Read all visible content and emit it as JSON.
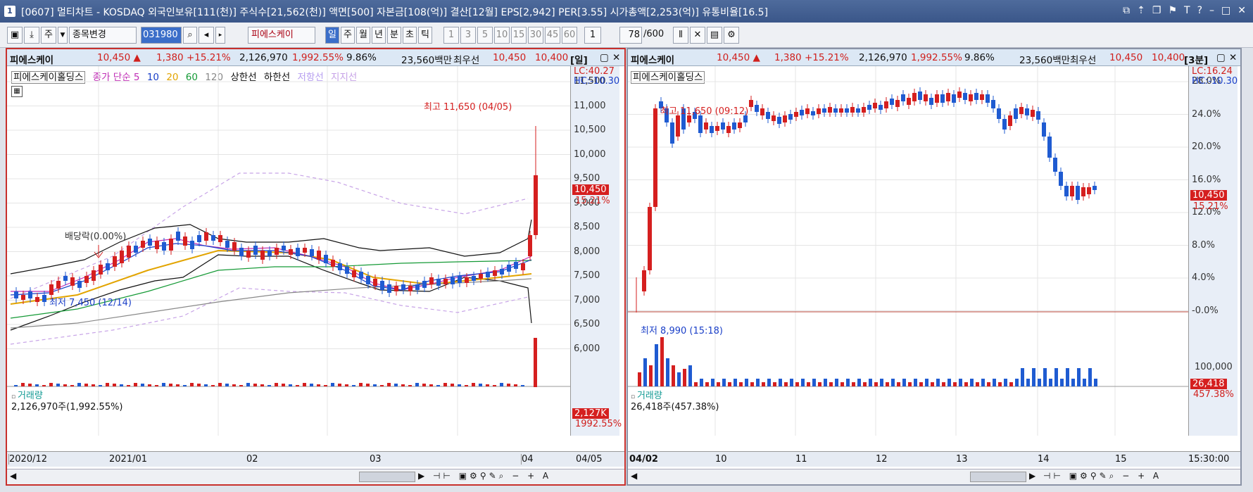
{
  "window": {
    "num": "1",
    "title": "[0607] 멀티차트 - KOSDAQ 외국인보유[111(천)] 주식수[21,562(천)] 액면[500] 자본금[108(억)] 결산[12월] EPS[2,942] PER[3.55] 시가총액[2,253(억)] 유통비율[16.5]"
  },
  "toolbar": {
    "period_type": "주",
    "mode": "종목변경",
    "code": "031980",
    "stock": "피에스케이",
    "periods": [
      "일",
      "주",
      "월",
      "년",
      "분",
      "초",
      "틱"
    ],
    "nums": [
      "1",
      "3",
      "5",
      "10",
      "15",
      "30",
      "45",
      "60"
    ],
    "count": "1",
    "ratio": "78",
    "total": "/600"
  },
  "left": {
    "header": {
      "name": "피에스케이",
      "price": "10,450 ▲",
      "change": "1,380 +15.21%",
      "volume": "2,126,970",
      "vol_pct": "1,992.55%",
      "turnover": "9.86%",
      "amount": "23,560백만",
      "bid_label": "최우선",
      "ask": "10,450",
      "bid": "10,400",
      "period": "[일]"
    },
    "legend": {
      "name": "피에스케이홀딩스",
      "close": "종가 단순 5",
      "ma10": "10",
      "ma20": "20",
      "ma60": "60",
      "ma120": "120",
      "upper": "상한선",
      "lower": "하한선",
      "resist": "저항선",
      "support": "지지선"
    },
    "lc": "LC:40.27",
    "hc": "HC:-10.30",
    "yticks": [
      "11,500",
      "11,000",
      "10,500",
      "10,000",
      "9,500",
      "9,000",
      "8,500",
      "8,000",
      "7,500",
      "7,000",
      "6,500",
      "6,000"
    ],
    "price_tag": "10,450",
    "pct_tag": "15.21%",
    "high_label": "최고 11,650 (04/05)",
    "low_label": "최저 7,450 (12/14)",
    "div_label": "배당락(0.00%)",
    "vol_title": "거래량",
    "vol_value": "2,126,970주(1,992.55%)",
    "vol_tag": "2,127K",
    "vol_pct_tag": "1992.55%",
    "xticks": [
      "2020/12",
      "2021/01",
      "02",
      "03",
      "04",
      "04/05"
    ]
  },
  "right": {
    "header": {
      "name": "피에스케이",
      "price": "10,450 ▲",
      "change": "1,380 +15.21%",
      "volume": "2,126,970",
      "vol_pct": "1,992.55%",
      "turnover": "9.86%",
      "amount": "23,560백만",
      "bid_label": "최우선",
      "ask": "10,450",
      "bid": "10,400",
      "period": "[3분]"
    },
    "legend": {
      "name": "피에스케이홀딩스"
    },
    "lc": "LC:16.24",
    "hc": "HC:-10.30",
    "yticks": [
      "28.0%",
      "24.0%",
      "20.0%",
      "16.0%",
      "12.0%",
      "8.0%",
      "4.0%",
      "-0.0%"
    ],
    "price_tag": "10,450",
    "pct_tag": "15.21%",
    "high_label": "최고 11,650 (09:12)",
    "low_label": "최저 8,990 (15:18)",
    "vol_title": "거래량",
    "vol_value": "26,418주(457.38%)",
    "vol_tick": "100,000",
    "vol_tag": "26,418",
    "vol_pct_tag": "457.38%",
    "xticks": [
      "04/02",
      "10",
      "11",
      "12",
      "13",
      "14",
      "15",
      "15:30:00"
    ]
  }
}
